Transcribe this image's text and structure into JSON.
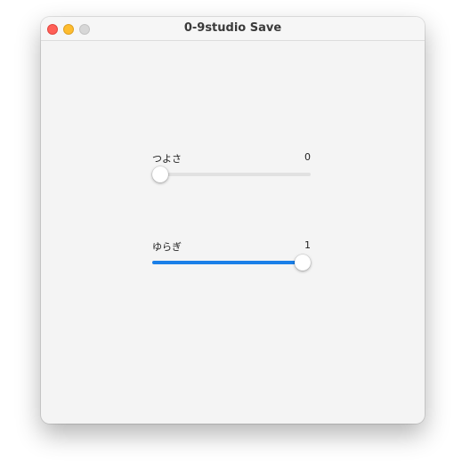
{
  "window": {
    "title": "0-9studio Save"
  },
  "sliders": [
    {
      "label": "つよさ",
      "value": "0",
      "fraction": 0
    },
    {
      "label": "ゆらぎ",
      "value": "1",
      "fraction": 1
    }
  ],
  "colors": {
    "accent": "#1a7fe8",
    "close": "#ff5f57",
    "minimize": "#febc2e",
    "zoom_inactive": "#d7d7d7",
    "background": "#f4f4f4"
  },
  "icons": {
    "close": "close-dot",
    "minimize": "minimize-dot",
    "zoom": "zoom-dot"
  }
}
